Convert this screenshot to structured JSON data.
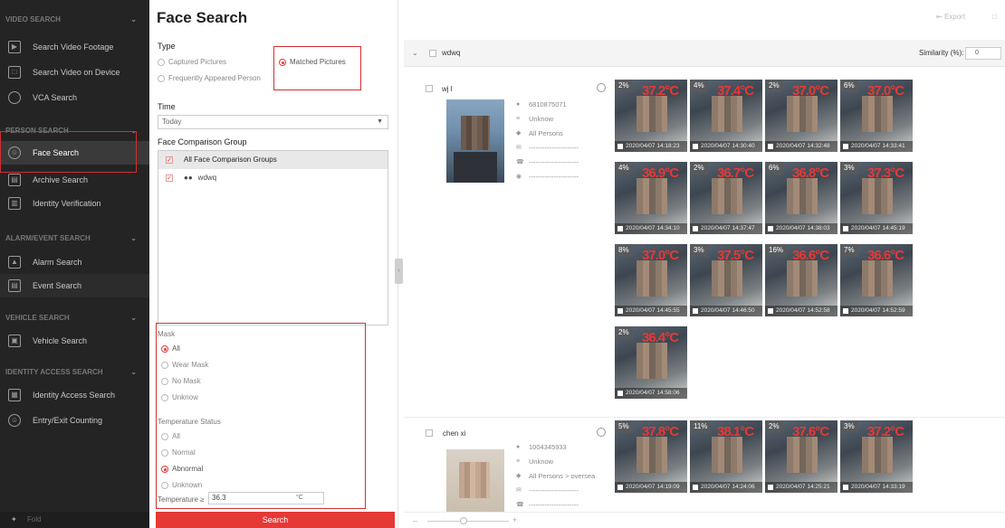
{
  "sidebar": {
    "sections": [
      {
        "title": "VIDEO SEARCH",
        "items": [
          {
            "label": "Search Video Footage",
            "icon": "video-footage-icon"
          },
          {
            "label": "Search Video on Device",
            "icon": "device-video-icon"
          },
          {
            "label": "VCA Search",
            "icon": "vca-icon"
          }
        ]
      },
      {
        "title": "PERSON SEARCH",
        "items": [
          {
            "label": "Face Search",
            "icon": "face-icon"
          },
          {
            "label": "Archive Search",
            "icon": "archive-icon"
          },
          {
            "label": "Identity Verification",
            "icon": "identity-icon"
          }
        ]
      },
      {
        "title": "ALARM/EVENT SEARCH",
        "items": [
          {
            "label": "Alarm Search",
            "icon": "alarm-icon"
          },
          {
            "label": "Event Search",
            "icon": "event-icon"
          }
        ]
      },
      {
        "title": "VEHICLE SEARCH",
        "items": [
          {
            "label": "Vehicle Search",
            "icon": "vehicle-icon"
          }
        ]
      },
      {
        "title": "IDENTITY ACCESS SEARCH",
        "items": [
          {
            "label": "Identity Access Search",
            "icon": "access-icon"
          },
          {
            "label": "Entry/Exit Counting",
            "icon": "counting-icon"
          }
        ]
      }
    ],
    "bottom_label": "Fold"
  },
  "panel": {
    "title": "Face Search",
    "type_label": "Type",
    "type_options": [
      "Captured Pictures",
      "Matched Pictures",
      "Frequently Appeared Person"
    ],
    "type_selected": "Matched Pictures",
    "time_label": "Time",
    "time_value": "Today",
    "group_label": "Face Comparison Group",
    "groups": [
      "All Face Comparison Groups",
      "wdwq"
    ],
    "mask_label": "Mask",
    "mask_options": [
      "All",
      "Wear Mask",
      "No Mask",
      "Unknow"
    ],
    "mask_selected": "All",
    "temp_label": "Temperature Status",
    "temp_options": [
      "All",
      "Normal",
      "Abnormal",
      "Unknown"
    ],
    "temp_selected": "Abnormal",
    "temp_threshold_label": "Temperature ≥",
    "temp_threshold_value": "36.3",
    "temp_unit": "°C",
    "search_button": "Search"
  },
  "results": {
    "export_label": "Export",
    "group_name": "wdwq",
    "similarity_label": "Similarity (%):",
    "similarity_value": "0",
    "persons": [
      {
        "name": "wj l",
        "id": "6810875071",
        "gender": "Unknow",
        "group": "All Persons",
        "email": "----------------------",
        "phone": "----------------------",
        "other": "----------------------",
        "captures": [
          {
            "pct": "2%",
            "temp": "37.2°C",
            "time": "2020/04/07 14:18:23"
          },
          {
            "pct": "4%",
            "temp": "37.4°C",
            "time": "2020/04/07 14:30:40"
          },
          {
            "pct": "2%",
            "temp": "37.0°C",
            "time": "2020/04/07 14:32:48"
          },
          {
            "pct": "6%",
            "temp": "37.0°C",
            "time": "2020/04/07 14:33:41"
          },
          {
            "pct": "4%",
            "temp": "36.9°C",
            "time": "2020/04/07 14:34:10"
          },
          {
            "pct": "2%",
            "temp": "36.7°C",
            "time": "2020/04/07 14:37:47"
          },
          {
            "pct": "6%",
            "temp": "36.8°C",
            "time": "2020/04/07 14:38:03"
          },
          {
            "pct": "3%",
            "temp": "37.3°C",
            "time": "2020/04/07 14:45:19"
          },
          {
            "pct": "8%",
            "temp": "37.0°C",
            "time": "2020/04/07 14:45:55"
          },
          {
            "pct": "3%",
            "temp": "37.5°C",
            "time": "2020/04/07 14:46:50"
          },
          {
            "pct": "16%",
            "temp": "36.6°C",
            "time": "2020/04/07 14:52:58"
          },
          {
            "pct": "7%",
            "temp": "36.6°C",
            "time": "2020/04/07 14:52:59"
          },
          {
            "pct": "2%",
            "temp": "36.4°C",
            "time": "2020/04/07 14:58:06"
          }
        ]
      },
      {
        "name": "chen xi",
        "id": "1004345933",
        "gender": "Unknow",
        "group": "All Persons > oversea",
        "email": "----------------------",
        "phone": "----------------------",
        "captures": [
          {
            "pct": "5%",
            "temp": "37.8°C",
            "time": "2020/04/07 14:19:09"
          },
          {
            "pct": "11%",
            "temp": "38.1°C",
            "time": "2020/04/07 14:24:06"
          },
          {
            "pct": "2%",
            "temp": "37.6°C",
            "time": "2020/04/07 14:25:21"
          },
          {
            "pct": "3%",
            "temp": "37.2°C",
            "time": "2020/04/07 14:33:19"
          }
        ]
      }
    ]
  }
}
